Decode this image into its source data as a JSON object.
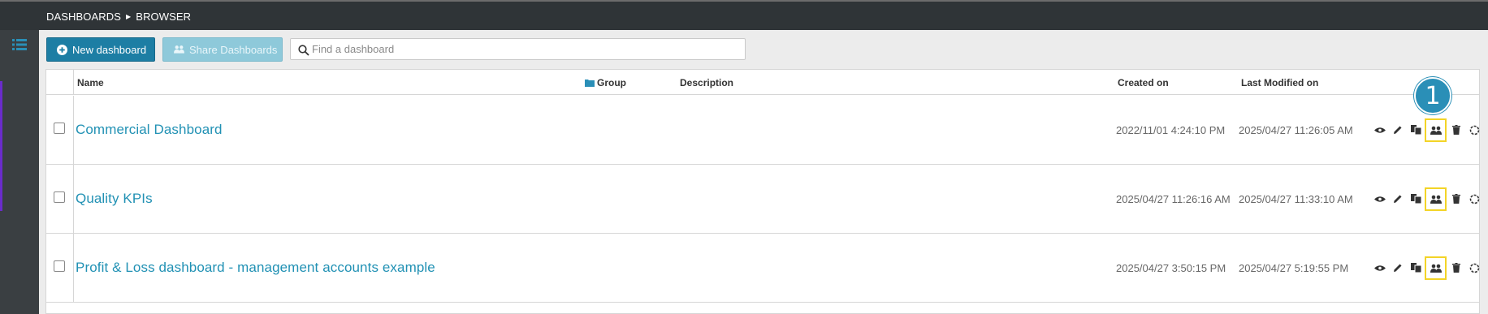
{
  "breadcrumb": {
    "root": "DASHBOARDS",
    "current": "BROWSER"
  },
  "sidebar": {
    "icon": "list-icon",
    "accent_color": "#6a2ccb"
  },
  "toolbar": {
    "new_label": "New dashboard",
    "share_label": "Share Dashboards",
    "search_placeholder": "Find a dashboard"
  },
  "table": {
    "columns": {
      "name": "Name",
      "group": "Group",
      "description": "Description",
      "created": "Created on",
      "modified": "Last Modified on"
    },
    "rows": [
      {
        "name": "Commercial Dashboard",
        "created": "2022/11/01 4:24:10 PM",
        "modified": "2025/04/27 11:26:05 AM"
      },
      {
        "name": "Quality KPIs",
        "created": "2025/04/27 11:26:16 AM",
        "modified": "2025/04/27 11:33:10 AM"
      },
      {
        "name": "Profit & Loss dashboard - management accounts example",
        "created": "2025/04/27 3:50:15 PM",
        "modified": "2025/04/27 5:19:55 PM"
      }
    ],
    "row_actions": [
      "eye-icon",
      "pencil-icon",
      "copy-icon",
      "share-users-icon",
      "trash-icon",
      "settings-icon"
    ]
  },
  "annotation": {
    "label": "1",
    "color": "#2a8fb7",
    "highlight_color": "#f3d427"
  },
  "colors": {
    "primary": "#1d7ea4",
    "link": "#2191b4",
    "topbar": "#2f3437"
  }
}
